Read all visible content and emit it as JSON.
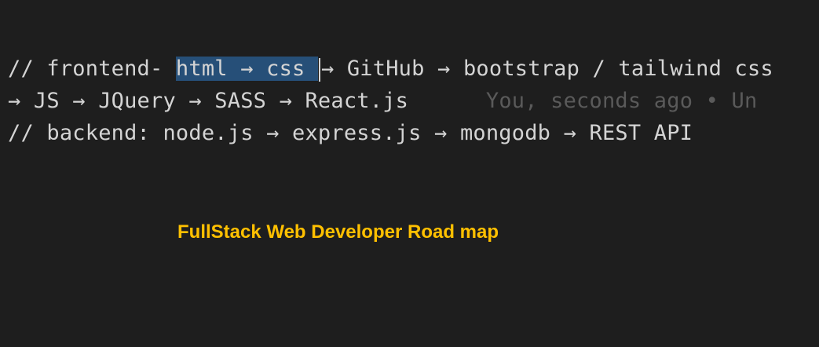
{
  "editor": {
    "line1": {
      "prefix": "// frontend- ",
      "selected": "html → css ",
      "suffix": "→ GitHub → bootstrap / tailwind css"
    },
    "line2": {
      "code": "→ JS → JQuery → SASS → React.js",
      "blame": "You, seconds ago • Un"
    },
    "line3": {
      "code": "// backend: node.js → express.js → mongodb → REST API"
    }
  },
  "caption": "FullStack Web Developer Road map",
  "colors": {
    "background": "#1e1e1e",
    "code_text": "#d4d4d4",
    "selection": "#264f78",
    "blame_text": "#5a5a5a",
    "caption": "#ffc000"
  }
}
